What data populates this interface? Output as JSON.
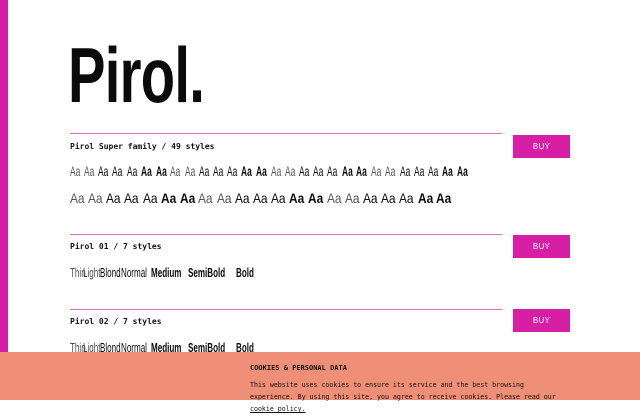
{
  "brand": {
    "logo_text": "Pirol."
  },
  "families": [
    {
      "label": "Pirol Super family / 49 styles",
      "buy_label": "BUY",
      "sample_rows": [
        [
          "Aa",
          "Aa",
          "Aa",
          "Aa",
          "Aa",
          "Aa",
          "Aa",
          "Aa",
          "Aa",
          "Aa",
          "Aa",
          "Aa",
          "Aa",
          "Aa",
          "Aa",
          "Aa",
          "Aa",
          "Aa",
          "Aa",
          "Aa",
          "Aa",
          "Aa",
          "Aa",
          "Aa",
          "Aa",
          "Aa",
          "Aa",
          "Aa"
        ],
        [
          "Aa",
          "Aa",
          "Aa",
          "Aa",
          "Aa",
          "Aa",
          "Aa",
          "Aa",
          "Aa",
          "Aa",
          "Aa",
          "Aa",
          "Aa",
          "Aa",
          "Aa",
          "Aa",
          "Aa",
          "Aa",
          "Aa",
          "Aa",
          "Aa"
        ]
      ]
    },
    {
      "label": "Pirol 01 / 7 styles",
      "buy_label": "BUY",
      "weights": [
        "Thin",
        "Light",
        "Blond",
        "Normal",
        "Medium",
        "SemiBold",
        "Bold"
      ]
    },
    {
      "label": "Pirol 02 / 7 styles",
      "buy_label": "BUY",
      "weights": [
        "Thin",
        "Light",
        "Blond",
        "Normal",
        "Medium",
        "SemiBold",
        "Bold"
      ]
    }
  ],
  "cookie": {
    "title": "COOKIES & PERSONAL DATA",
    "text": "This website uses cookies to ensure its service and the best browsing experience. By using this site, you agree to receive cookies. Please read our",
    "link_label": "cookie policy."
  },
  "colors": {
    "accent": "#d61fa4",
    "cookie_bg": "#ef8f78",
    "rule": "#d86fc2"
  }
}
